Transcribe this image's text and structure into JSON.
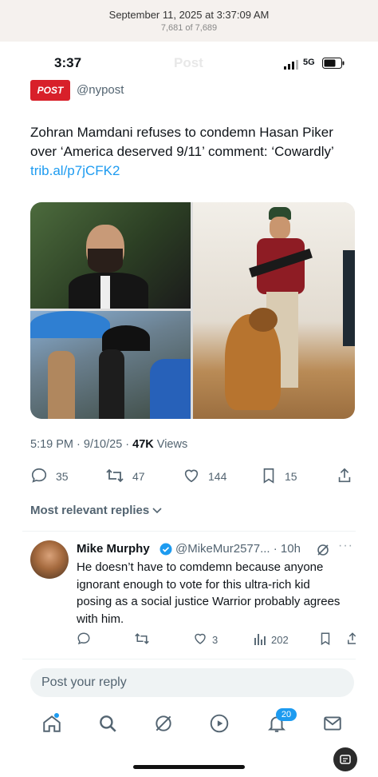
{
  "banner": {
    "date": "September 11, 2025 at 3:37:09 AM",
    "count": "7,681 of 7,689"
  },
  "status_bar": {
    "time": "3:37",
    "network": "5G",
    "ghost_title": "Post"
  },
  "author": {
    "logo_text": "POST",
    "handle": "@nypost"
  },
  "tweet": {
    "text": "Zohran Mamdani refuses to condemn Hasan Piker over ‘America deserved 9/11’ comment: ‘Cowardly’ ",
    "link": "trib.al/p7jCFK2",
    "time": "5:19 PM · 9/10/25 · ",
    "views_count": "47K",
    "views_label": " Views"
  },
  "actions": {
    "replies": "35",
    "reposts": "47",
    "likes": "144",
    "bookmarks": "15"
  },
  "replies_filter": "Most relevant replies",
  "reply": {
    "name": "Mike Murphy",
    "handle": "@MikeMur2577... · 10h",
    "text": "He doesn’t have to comdemn because anyone ignorant enough to vote for this ultra-rich kid posing as a social justice Warrior probably agrees with him.",
    "likes": "3",
    "views": "202"
  },
  "reply_placeholder": "Post your reply",
  "tabbar": {
    "notification_badge": "20"
  },
  "colors": {
    "accent": "#1d9bf0",
    "muted": "#536471",
    "text": "#0f1419",
    "brand_red": "#d8202a"
  }
}
